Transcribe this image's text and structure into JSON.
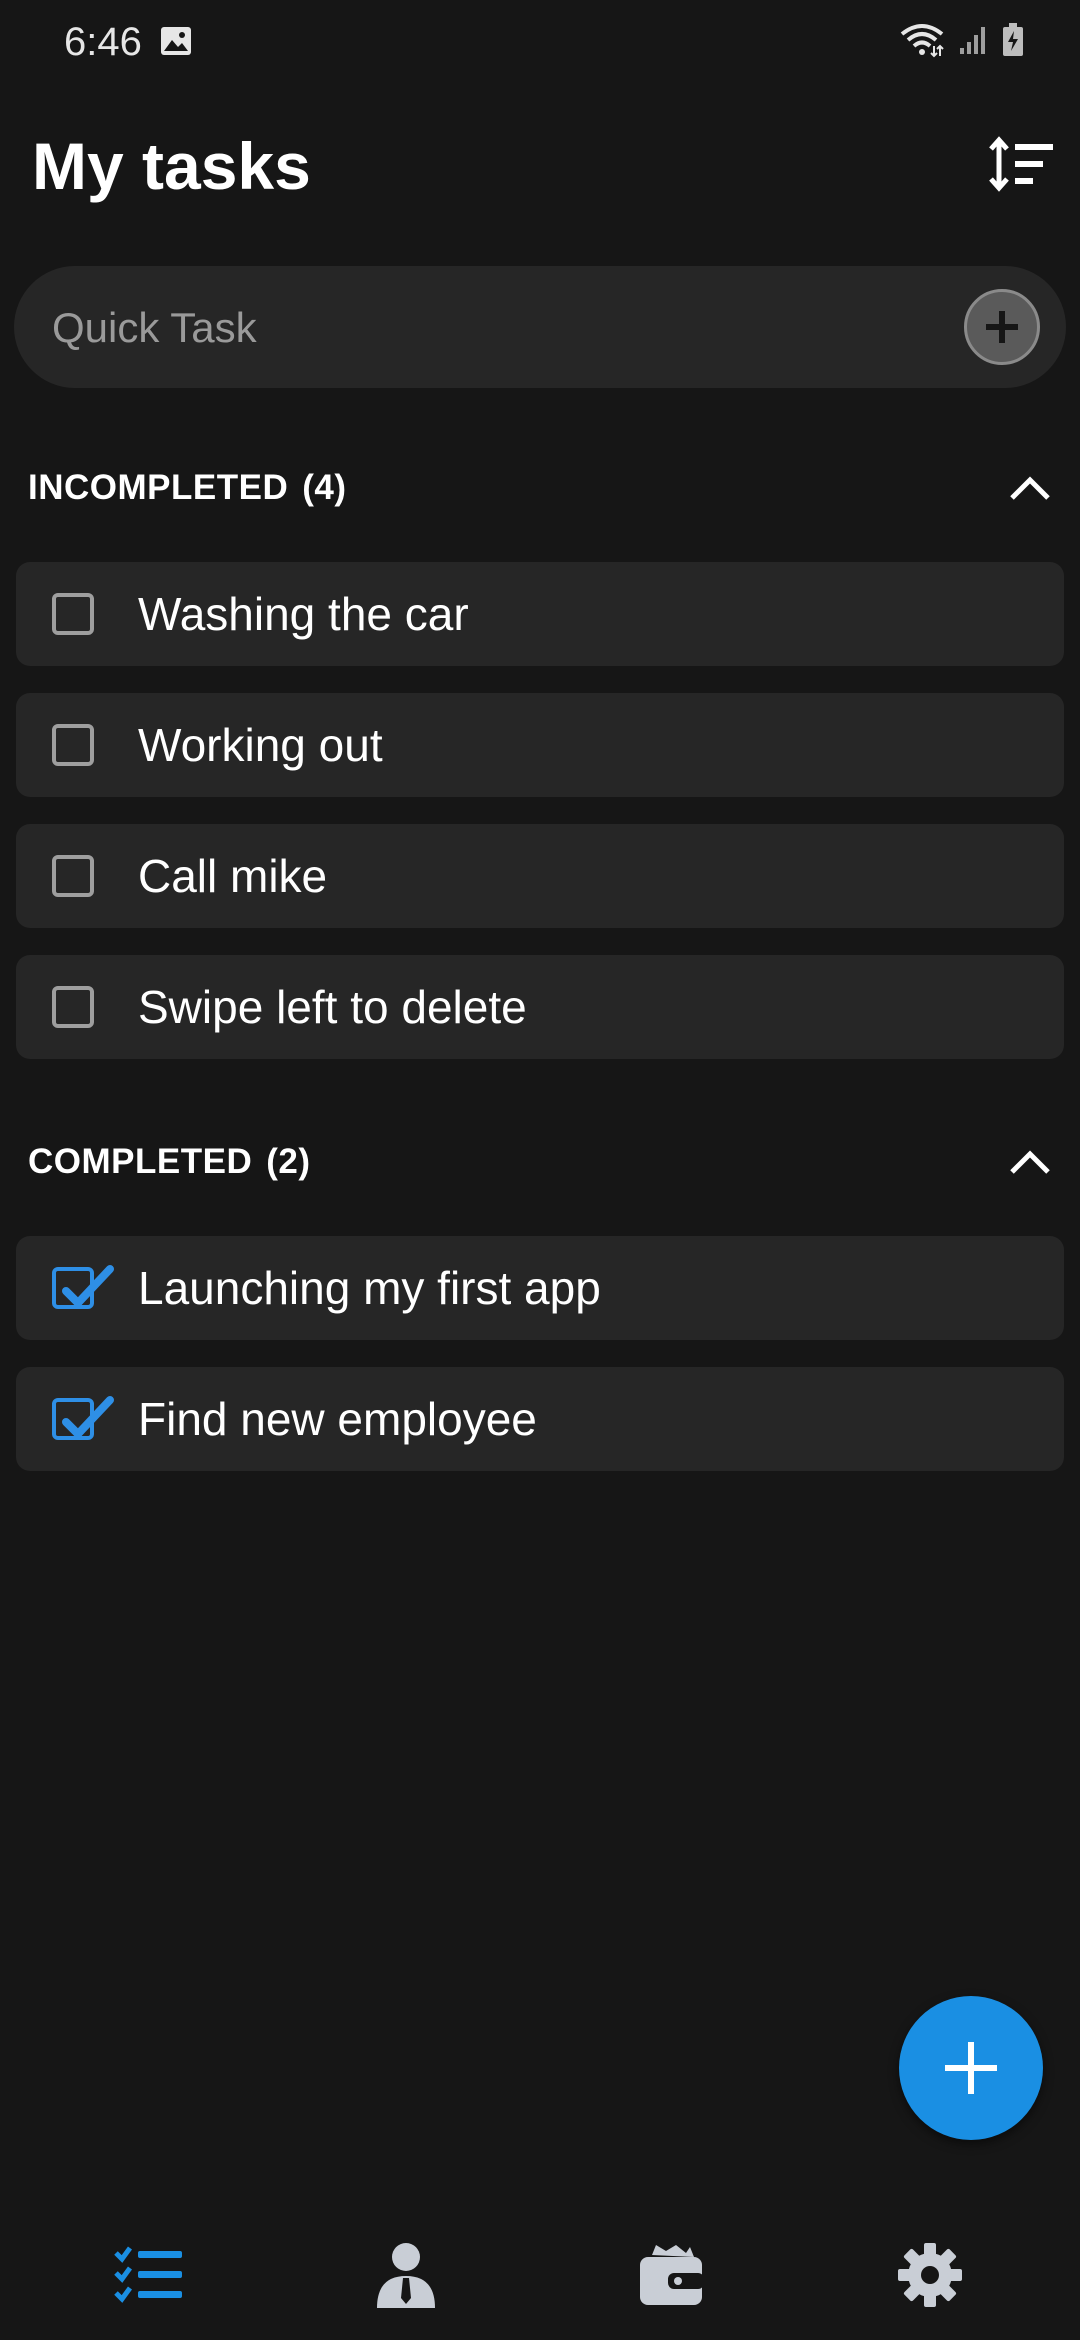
{
  "status_bar": {
    "time": "6:46"
  },
  "header": {
    "title": "My tasks"
  },
  "quick_task": {
    "placeholder": "Quick Task",
    "value": ""
  },
  "incompleted": {
    "title": "INCOMPLETED",
    "count": "(4)",
    "tasks": [
      {
        "label": "Washing the car",
        "checked": false
      },
      {
        "label": "Working out",
        "checked": false
      },
      {
        "label": "Call mike",
        "checked": false
      },
      {
        "label": "Swipe left to delete",
        "checked": false
      }
    ]
  },
  "completed": {
    "title": "COMPLETED",
    "count": "(2)",
    "tasks": [
      {
        "label": "Launching my first app",
        "checked": true
      },
      {
        "label": "Find new employee",
        "checked": true
      }
    ]
  },
  "bottom_nav": {
    "items": [
      {
        "icon": "task-list-icon",
        "active": true
      },
      {
        "icon": "person-icon",
        "active": false
      },
      {
        "icon": "wallet-icon",
        "active": false
      },
      {
        "icon": "gear-icon",
        "active": false
      }
    ]
  },
  "colors": {
    "background": "#161616",
    "card": "#262626",
    "accent": "#1a8fe3",
    "checkbox_checked": "#2e8fe6",
    "checkbox_unchecked": "#9e9e9e",
    "inactive_icon": "#c9ced6"
  }
}
